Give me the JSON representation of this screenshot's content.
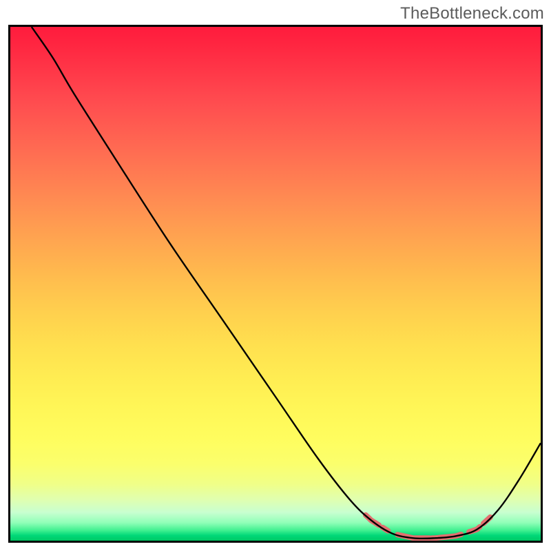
{
  "watermark": "TheBottleneck.com",
  "chart_data": {
    "type": "line",
    "title": "",
    "xlabel": "",
    "ylabel": "",
    "xlim": [
      0,
      100
    ],
    "ylim": [
      0,
      100
    ],
    "grid": false,
    "legend": false,
    "curve": [
      {
        "x": 4,
        "y": 100
      },
      {
        "x": 8,
        "y": 94
      },
      {
        "x": 12,
        "y": 87
      },
      {
        "x": 20,
        "y": 74
      },
      {
        "x": 30,
        "y": 58
      },
      {
        "x": 40,
        "y": 43
      },
      {
        "x": 50,
        "y": 28
      },
      {
        "x": 58,
        "y": 16
      },
      {
        "x": 64,
        "y": 8
      },
      {
        "x": 68,
        "y": 4
      },
      {
        "x": 72,
        "y": 1.4
      },
      {
        "x": 76,
        "y": 0.5
      },
      {
        "x": 80,
        "y": 0.5
      },
      {
        "x": 84,
        "y": 0.9
      },
      {
        "x": 88,
        "y": 2.2
      },
      {
        "x": 92,
        "y": 6
      },
      {
        "x": 96,
        "y": 12
      },
      {
        "x": 100,
        "y": 19
      }
    ],
    "dash_segments_x": [
      [
        67,
        69.5
      ],
      [
        70.2,
        71.2
      ],
      [
        73,
        79
      ],
      [
        79.5,
        85
      ],
      [
        86.5,
        88.5
      ],
      [
        89.2,
        90.5
      ]
    ],
    "dash_color": "#e26f6f",
    "curve_color": "#000000",
    "curve_width": 2.4,
    "dash_width": 8
  }
}
